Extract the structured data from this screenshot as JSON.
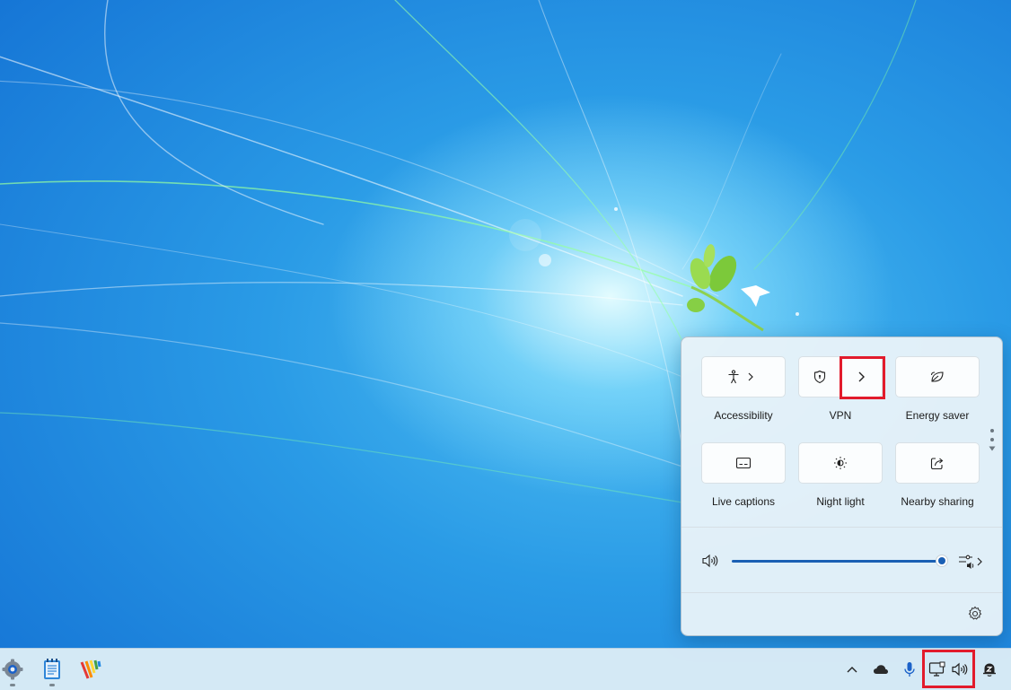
{
  "quick_settings": {
    "tiles": [
      {
        "label": "Accessibility",
        "icon": "accessibility-icon",
        "has_chevron": true
      },
      {
        "label": "VPN",
        "icon": "shield-icon",
        "has_chevron": true
      },
      {
        "label": "Energy saver",
        "icon": "leaf-icon"
      },
      {
        "label": "Live captions",
        "icon": "captions-icon"
      },
      {
        "label": "Night light",
        "icon": "brightness-icon"
      },
      {
        "label": "Nearby sharing",
        "icon": "share-icon"
      }
    ],
    "volume": {
      "level_percent": 100,
      "icon": "speaker-icon",
      "mixer_icon": "audio-mixer-icon"
    },
    "settings_icon": "gear-icon",
    "highlight_color": "#e21b2c",
    "accent_color": "#1a5fb4"
  },
  "taskbar": {
    "apps": [
      {
        "name": "settings",
        "icon": "gear-app-icon"
      },
      {
        "name": "notepad",
        "icon": "notepad-app-icon"
      },
      {
        "name": "paint-app",
        "icon": "color-stripes-app-icon"
      }
    ],
    "tray": [
      "chevron-up-icon",
      "cloud-icon",
      "microphone-icon",
      "network-icon",
      "speaker-icon",
      "notification-icon"
    ]
  }
}
